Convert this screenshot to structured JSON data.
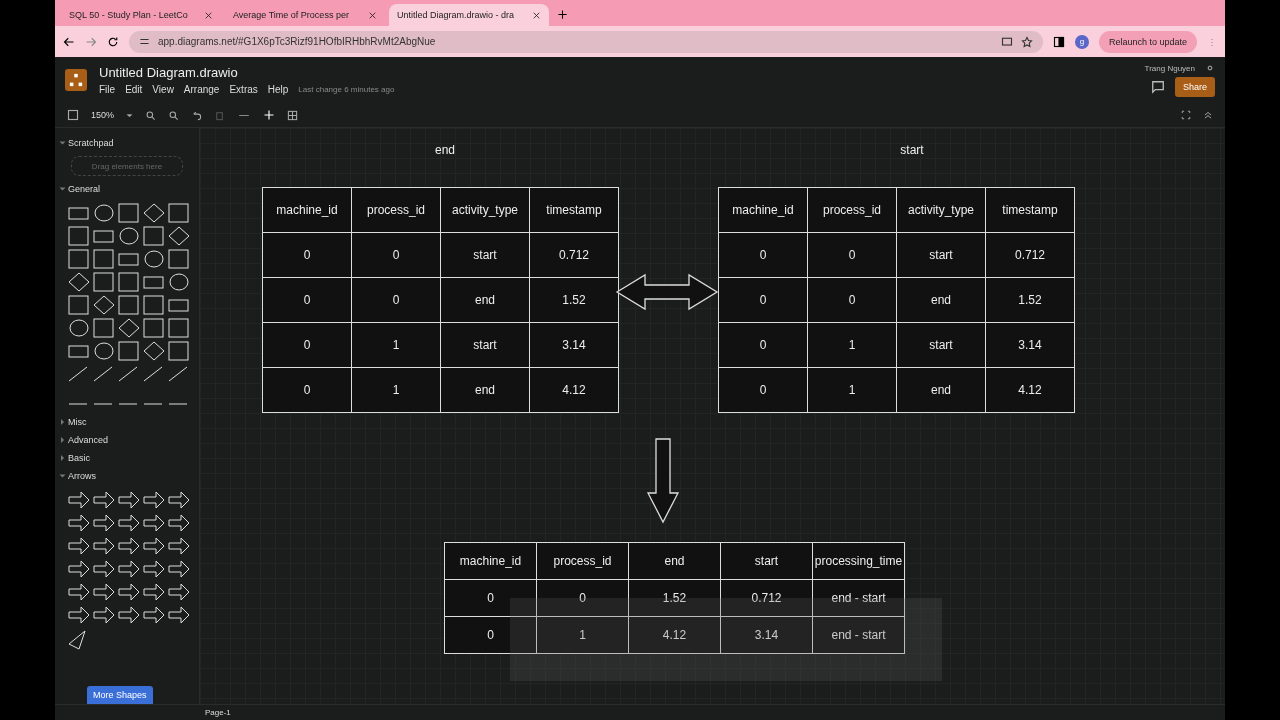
{
  "browser": {
    "tabs": [
      {
        "title": "SQL 50 - Study Plan - LeetCo",
        "selected": false
      },
      {
        "title": "Average Time of Process per",
        "selected": false
      },
      {
        "title": "Untitled Diagram.drawio - dra",
        "selected": true
      }
    ],
    "url": "app.diagrams.net/#G1X6pTc3Rizf91HOfbIRHbhRvMt2AbgNue",
    "profile": "g",
    "relaunch": "Relaunch to update"
  },
  "app": {
    "title": "Untitled Diagram.drawio",
    "menus": [
      "File",
      "Edit",
      "View",
      "Arrange",
      "Extras",
      "Help"
    ],
    "last_change": "Last change 6 minutes ago",
    "user": "Trang Nguyen",
    "share": "Share",
    "zoom": "150%"
  },
  "sidebar": {
    "scratchpad": {
      "title": "Scratchpad",
      "placeholder": "Drag elements here"
    },
    "sections": [
      {
        "title": "General",
        "expanded": true,
        "kind": "general"
      },
      {
        "title": "Misc",
        "expanded": false
      },
      {
        "title": "Advanced",
        "expanded": false
      },
      {
        "title": "Basic",
        "expanded": false
      },
      {
        "title": "Arrows",
        "expanded": true,
        "kind": "arrows"
      }
    ],
    "more_shapes": "More Shapes"
  },
  "canvas": {
    "labels": [
      {
        "text": "end"
      },
      {
        "text": "start"
      }
    ],
    "tables": [
      {
        "columns": [
          "machine_id",
          "process_id",
          "activity_type",
          "timestamp"
        ],
        "rows": [
          [
            "0",
            "0",
            "start",
            "0.712"
          ],
          [
            "0",
            "0",
            "end",
            "1.52"
          ],
          [
            "0",
            "1",
            "start",
            "3.14"
          ],
          [
            "0",
            "1",
            "end",
            "4.12"
          ]
        ]
      },
      {
        "columns": [
          "machine_id",
          "process_id",
          "activity_type",
          "timestamp"
        ],
        "rows": [
          [
            "0",
            "0",
            "start",
            "0.712"
          ],
          [
            "0",
            "0",
            "end",
            "1.52"
          ],
          [
            "0",
            "1",
            "start",
            "3.14"
          ],
          [
            "0",
            "1",
            "end",
            "4.12"
          ]
        ]
      },
      {
        "columns": [
          "machine_id",
          "process_id",
          "end",
          "start",
          "processing_time"
        ],
        "rows": [
          [
            "0",
            "0",
            "1.52",
            "0.712",
            "end - start"
          ],
          [
            "0",
            "1",
            "4.12",
            "3.14",
            "end - start"
          ]
        ]
      }
    ]
  },
  "pages": [
    {
      "title": "Page-1",
      "selected": true
    }
  ]
}
